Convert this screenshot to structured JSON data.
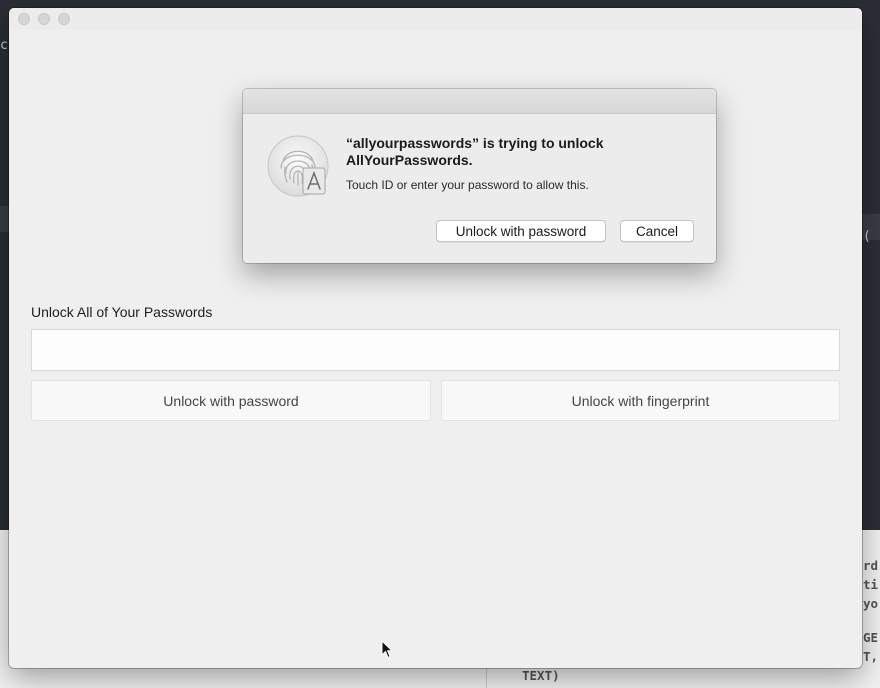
{
  "background": {
    "left_fragment": "c",
    "right_fragment": "( s",
    "code_right_lines": [
      "rd",
      "ti",
      "yo",
      "",
      "GE",
      "T,"
    ],
    "code_bottom": "TEXT)"
  },
  "form": {
    "label": "Unlock All of Your Passwords",
    "password_value": "",
    "unlock_password_label": "Unlock with password",
    "unlock_fingerprint_label": "Unlock with fingerprint"
  },
  "dialog": {
    "title_line1": "“allyourpasswords” is trying to unlock",
    "title_line2": "AllYourPasswords.",
    "message": "Touch ID or enter your password to allow this.",
    "unlock_button": "Unlock with password",
    "cancel_button": "Cancel"
  },
  "icons": {
    "dialog_icon": "fingerprint-icon",
    "badge_icon": "app-store-badge-icon",
    "pointer": "mouse-pointer-icon"
  }
}
